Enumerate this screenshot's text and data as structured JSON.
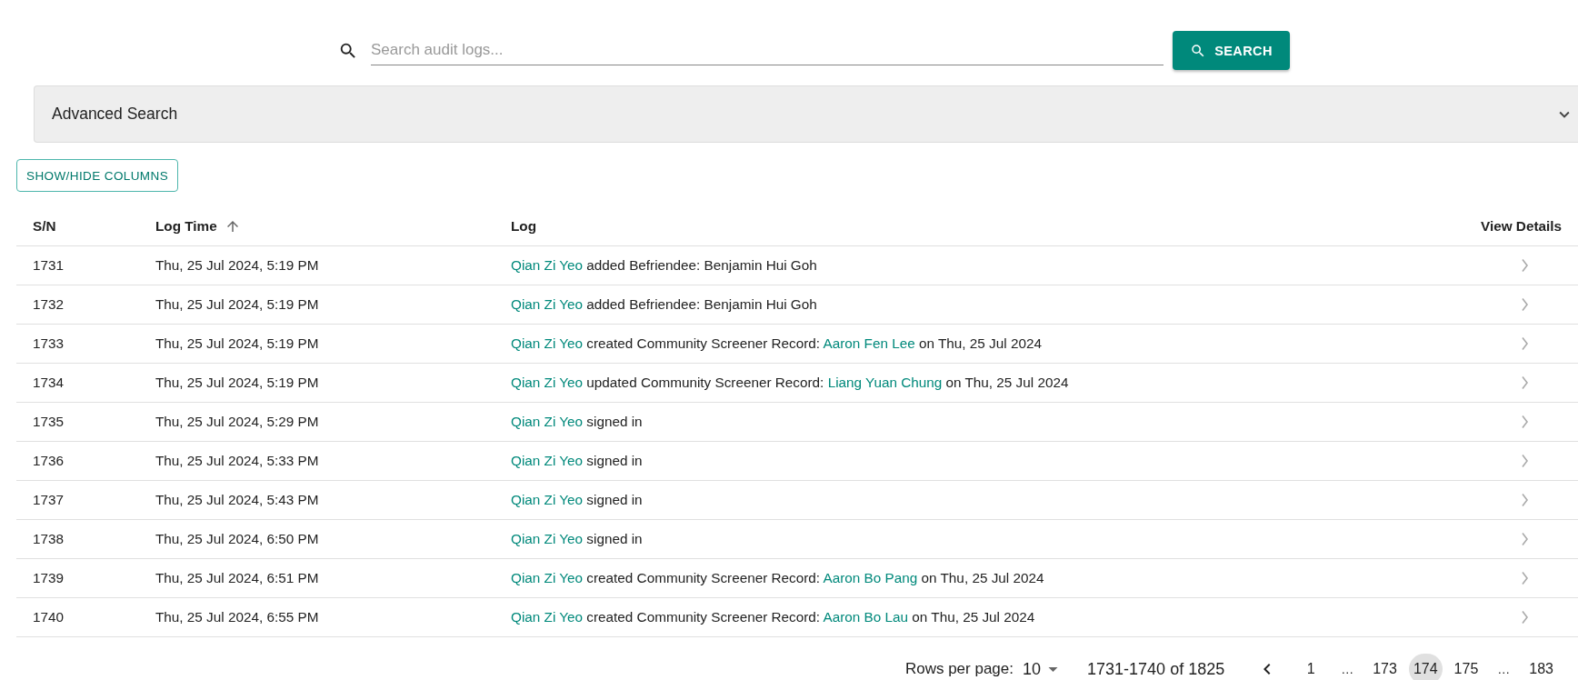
{
  "search": {
    "placeholder": "Search audit logs...",
    "button": "SEARCH"
  },
  "advanced_search": {
    "title": "Advanced Search",
    "expanded": false
  },
  "show_hide_columns": "SHOW/HIDE COLUMNS",
  "table": {
    "columns": [
      {
        "label": "S/N"
      },
      {
        "label": "Log Time",
        "sorted": true
      },
      {
        "label": "Log"
      },
      {
        "label": "View Details"
      }
    ],
    "rows": [
      {
        "sn": "1731",
        "time": "Thu, 25 Jul 2024, 5:19 PM",
        "log": [
          {
            "text": "Qian Zi Yeo",
            "kind": "link"
          },
          {
            "text": " added Befriendee: Benjamin Hui Goh",
            "kind": "text"
          }
        ]
      },
      {
        "sn": "1732",
        "time": "Thu, 25 Jul 2024, 5:19 PM",
        "log": [
          {
            "text": "Qian Zi Yeo",
            "kind": "link"
          },
          {
            "text": " added Befriendee: Benjamin Hui Goh",
            "kind": "text"
          }
        ]
      },
      {
        "sn": "1733",
        "time": "Thu, 25 Jul 2024, 5:19 PM",
        "log": [
          {
            "text": "Qian Zi Yeo",
            "kind": "link"
          },
          {
            "text": " created Community Screener Record: ",
            "kind": "text"
          },
          {
            "text": "Aaron Fen Lee",
            "kind": "link"
          },
          {
            "text": " on Thu, 25 Jul 2024",
            "kind": "text"
          }
        ]
      },
      {
        "sn": "1734",
        "time": "Thu, 25 Jul 2024, 5:19 PM",
        "log": [
          {
            "text": "Qian Zi Yeo",
            "kind": "link"
          },
          {
            "text": " updated Community Screener Record: ",
            "kind": "text"
          },
          {
            "text": "Liang Yuan Chung",
            "kind": "link"
          },
          {
            "text": " on Thu, 25 Jul 2024",
            "kind": "text"
          }
        ]
      },
      {
        "sn": "1735",
        "time": "Thu, 25 Jul 2024, 5:29 PM",
        "log": [
          {
            "text": "Qian Zi Yeo",
            "kind": "link"
          },
          {
            "text": " signed in",
            "kind": "text"
          }
        ]
      },
      {
        "sn": "1736",
        "time": "Thu, 25 Jul 2024, 5:33 PM",
        "log": [
          {
            "text": "Qian Zi Yeo",
            "kind": "link"
          },
          {
            "text": " signed in",
            "kind": "text"
          }
        ]
      },
      {
        "sn": "1737",
        "time": "Thu, 25 Jul 2024, 5:43 PM",
        "log": [
          {
            "text": "Qian Zi Yeo",
            "kind": "link"
          },
          {
            "text": " signed in",
            "kind": "text"
          }
        ]
      },
      {
        "sn": "1738",
        "time": "Thu, 25 Jul 2024, 6:50 PM",
        "log": [
          {
            "text": "Qian Zi Yeo",
            "kind": "link"
          },
          {
            "text": " signed in",
            "kind": "text"
          }
        ]
      },
      {
        "sn": "1739",
        "time": "Thu, 25 Jul 2024, 6:51 PM",
        "log": [
          {
            "text": "Qian Zi Yeo",
            "kind": "link"
          },
          {
            "text": " created Community Screener Record: ",
            "kind": "text"
          },
          {
            "text": "Aaron Bo Pang",
            "kind": "link"
          },
          {
            "text": " on Thu, 25 Jul 2024",
            "kind": "text"
          }
        ]
      },
      {
        "sn": "1740",
        "time": "Thu, 25 Jul 2024, 6:55 PM",
        "log": [
          {
            "text": "Qian Zi Yeo",
            "kind": "link"
          },
          {
            "text": " created Community Screener Record: ",
            "kind": "text"
          },
          {
            "text": "Aaron Bo Lau",
            "kind": "link"
          },
          {
            "text": " on Thu, 25 Jul 2024",
            "kind": "text"
          }
        ]
      }
    ]
  },
  "pagination": {
    "rows_per_page_label": "Rows per page:",
    "rows_per_page": "10",
    "range": "1731-1740 of 1825",
    "pages": [
      {
        "label": "1",
        "kind": "page",
        "selected": false
      },
      {
        "label": "…",
        "kind": "ellipsis",
        "selected": false
      },
      {
        "label": "173",
        "kind": "page",
        "selected": false
      },
      {
        "label": "174",
        "kind": "page",
        "selected": true
      },
      {
        "label": "175",
        "kind": "page",
        "selected": false
      },
      {
        "label": "…",
        "kind": "ellipsis",
        "selected": false
      },
      {
        "label": "183",
        "kind": "page",
        "selected": false
      }
    ]
  }
}
